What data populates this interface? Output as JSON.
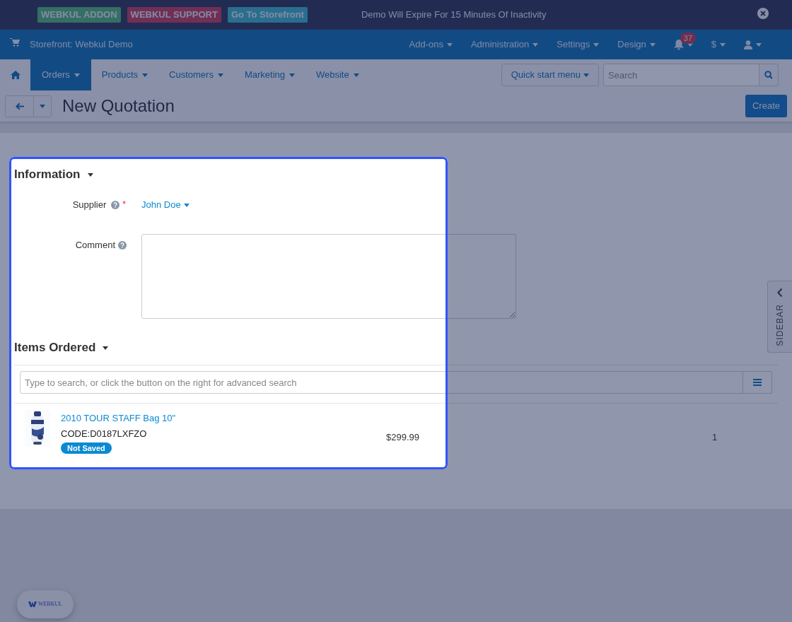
{
  "demo_bar": {
    "buttons": [
      {
        "label": "WEBKUL ADDON",
        "kind": "addon"
      },
      {
        "label": "WEBKUL SUPPORT",
        "kind": "support"
      },
      {
        "label": "Go To Storefront",
        "kind": "storefront"
      }
    ],
    "notice": "Demo Will Expire For 15 Minutes Of Inactivity"
  },
  "top_nav": {
    "storefront": "Storefront: Webkul Demo",
    "menus": [
      {
        "kind": "text",
        "label": "Add-ons"
      },
      {
        "kind": "text",
        "label": "Administration"
      },
      {
        "kind": "text",
        "label": "Settings"
      },
      {
        "kind": "text",
        "label": "Design"
      },
      {
        "kind": "bell",
        "badge": "37"
      },
      {
        "kind": "text",
        "label": "$"
      },
      {
        "kind": "user"
      }
    ]
  },
  "main_nav": {
    "items": [
      {
        "label": "Orders",
        "selected": true
      },
      {
        "label": "Products",
        "selected": false
      },
      {
        "label": "Customers",
        "selected": false
      },
      {
        "label": "Marketing",
        "selected": false
      },
      {
        "label": "Website",
        "selected": false
      }
    ],
    "quick_start": "Quick start menu",
    "search_placeholder": "Search"
  },
  "toolbar": {
    "title": "New Quotation",
    "create_button": "Create"
  },
  "information": {
    "heading": "Information",
    "supplier_label": "Supplier",
    "required_mark": "*",
    "supplier_value": "John Doe",
    "comment_label": "Comment"
  },
  "items_ordered": {
    "heading": "Items Ordered",
    "search_placeholder": "Type to search, or click the button on the right for advanced search",
    "items": [
      {
        "name": "2010 TOUR STAFF Bag 10\"",
        "code": "CODE:D0187LXFZO",
        "status": "Not Saved",
        "price": "$299.99",
        "quantity": "1"
      }
    ]
  },
  "sidebar_tab": "SIDEBAR",
  "floating_badge": "WEBKUL"
}
